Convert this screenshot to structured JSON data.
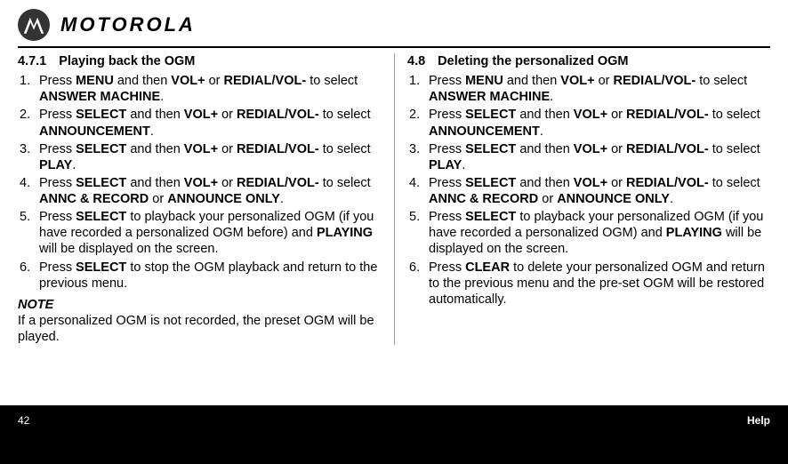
{
  "brand": "MOTOROLA",
  "left": {
    "secnum": "4.7.1",
    "title": "Playing back the OGM",
    "steps": [
      {
        "pre": "Press ",
        "b1": "MENU",
        "mid1": " and then ",
        "b2": "VOL+",
        "mid2": " or ",
        "b3": "REDIAL/VOL-",
        "mid3": " to select ",
        "b4": "ANSWER MACHINE",
        "post": "."
      },
      {
        "pre": "Press ",
        "b1": "SELECT",
        "mid1": " and then ",
        "b2": "VOL+",
        "mid2": " or ",
        "b3": "REDIAL/VOL-",
        "mid3": " to select ",
        "b4": "ANNOUNCEMENT",
        "post": "."
      },
      {
        "pre": "Press ",
        "b1": "SELECT",
        "mid1": " and then ",
        "b2": "VOL+",
        "mid2": " or ",
        "b3": "REDIAL/VOL-",
        "mid3": " to select ",
        "b4": "PLAY",
        "post": "."
      },
      {
        "pre": "Press ",
        "b1": "SELECT",
        "mid1": " and then ",
        "b2": "VOL+",
        "mid2": " or ",
        "b3": "REDIAL/VOL-",
        "mid3": " to select ",
        "b4": "ANNC & RECORD",
        "mid4": " or ",
        "b5": "ANNOUNCE ONLY",
        "post": "."
      },
      {
        "pre": "Press ",
        "b1": "SELECT",
        "mid1": " to playback your personalized OGM (if you have recorded a personalized OGM before) and ",
        "b2": "PLAYING",
        "post": " will be displayed on the screen."
      },
      {
        "pre": "Press ",
        "b1": "SELECT",
        "post": " to stop the OGM playback and return to the previous menu."
      }
    ],
    "note_title": "NOTE",
    "note_body": "If a personalized OGM is not recorded, the preset OGM will be played."
  },
  "right": {
    "secnum": "4.8",
    "title": "Deleting the personalized OGM",
    "steps": [
      {
        "pre": "Press ",
        "b1": "MENU",
        "mid1": " and then ",
        "b2": "VOL+",
        "mid2": " or ",
        "b3": "REDIAL/VOL-",
        "mid3": " to select ",
        "b4": "ANSWER MACHINE",
        "post": "."
      },
      {
        "pre": "Press ",
        "b1": "SELECT",
        "mid1": " and then ",
        "b2": "VOL+",
        "mid2": " or ",
        "b3": "REDIAL/VOL-",
        "mid3": " to select ",
        "b4": "ANNOUNCEMENT",
        "post": "."
      },
      {
        "pre": "Press ",
        "b1": "SELECT",
        "mid1": " and then ",
        "b2": "VOL+",
        "mid2": " or ",
        "b3": "REDIAL/VOL-",
        "mid3": " to select ",
        "b4": "PLAY",
        "post": "."
      },
      {
        "pre": "Press ",
        "b1": "SELECT",
        "mid1": " and then ",
        "b2": "VOL+",
        "mid2": " or ",
        "b3": "REDIAL/VOL-",
        "mid3": " to select ",
        "b4": "ANNC & RECORD",
        "mid4": " or ",
        "b5": "ANNOUNCE ONLY",
        "post": "."
      },
      {
        "pre": "Press ",
        "b1": "SELECT",
        "mid1": " to playback your personalized OGM (if you have recorded a personalized OGM) and ",
        "b2": "PLAYING",
        "post": " will be displayed on the screen."
      },
      {
        "pre": "Press ",
        "b1": "CLEAR",
        "post": " to delete your personalized OGM and return to the previous menu and the pre-set OGM will be restored automatically."
      }
    ]
  },
  "footer": {
    "page": "42",
    "help": "Help"
  }
}
